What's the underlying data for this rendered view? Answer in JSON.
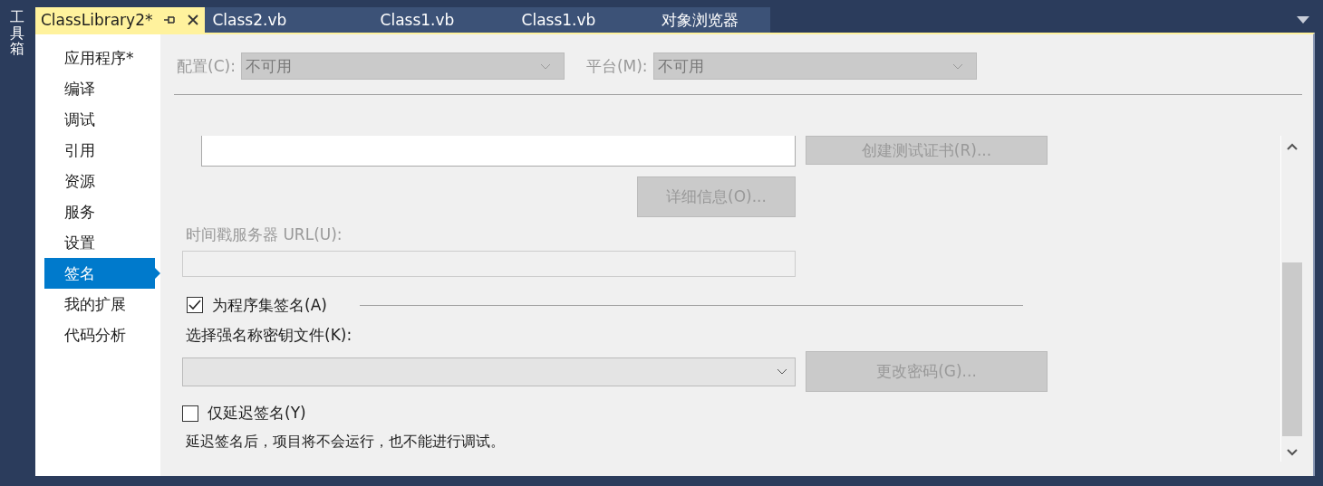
{
  "toolbox_label": "工具箱",
  "tabs": [
    {
      "label": "ClassLibrary2*",
      "selected": true
    },
    {
      "label": "Class2.vb",
      "selected": false
    },
    {
      "label": "Class1.vb",
      "selected": false
    },
    {
      "label": "Class1.vb",
      "selected": false
    },
    {
      "label": "对象浏览器",
      "selected": false
    }
  ],
  "sidebar": {
    "items": [
      {
        "label": "应用程序*",
        "selected": false
      },
      {
        "label": "编译",
        "selected": false
      },
      {
        "label": "调试",
        "selected": false
      },
      {
        "label": "引用",
        "selected": false
      },
      {
        "label": "资源",
        "selected": false
      },
      {
        "label": "服务",
        "selected": false
      },
      {
        "label": "设置",
        "selected": false
      },
      {
        "label": "签名",
        "selected": true
      },
      {
        "label": "我的扩展",
        "selected": false
      },
      {
        "label": "代码分析",
        "selected": false
      }
    ]
  },
  "configuration": {
    "label": "配置(C):",
    "value": "不可用",
    "disabled": true
  },
  "platform": {
    "label": "平台(M):",
    "value": "不可用",
    "disabled": true
  },
  "create_test_certificate_button": {
    "label": "创建测试证书(R)...",
    "disabled": true
  },
  "details_button": {
    "label": "详细信息(O)...",
    "disabled": true
  },
  "timestamp_server": {
    "label": "时间戳服务器 URL(U):",
    "disabled": true
  },
  "sign_assembly": {
    "label": "为程序集签名(A)",
    "checked": true
  },
  "key_file": {
    "label": "选择强名称密钥文件(K):"
  },
  "change_password_button": {
    "label": "更改密码(G)...",
    "disabled": true
  },
  "delay_sign": {
    "label": "仅延迟签名(Y)",
    "checked": false
  },
  "note": "延迟签名后，项目将不会运行，也不能进行调试。"
}
